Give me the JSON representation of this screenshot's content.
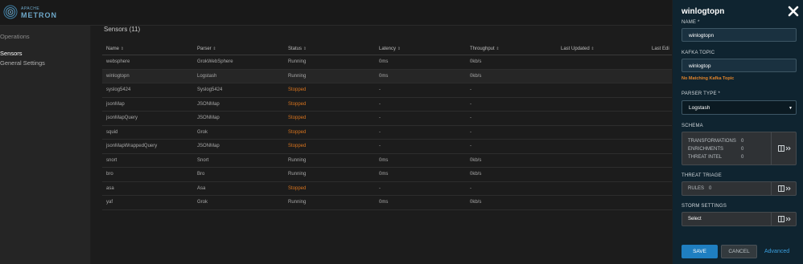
{
  "brand": {
    "small": "APACHE",
    "big": "METRON"
  },
  "nav": {
    "operations": "Operations",
    "sensors": "Sensors",
    "general_settings": "General Settings"
  },
  "main": {
    "title": "Sensors (11)",
    "columns": [
      "Name",
      "Parser",
      "Status",
      "Latency",
      "Throughput",
      "Last Updated",
      "Last Edi"
    ],
    "rows": [
      {
        "name": "websphere",
        "parser": "GrokWebSphere",
        "status": "Running",
        "latency": "0ms",
        "throughput": "0kb/s"
      },
      {
        "name": "winlogtopn",
        "parser": "Logstash",
        "status": "Running",
        "latency": "0ms",
        "throughput": "0kb/s"
      },
      {
        "name": "syslog5424",
        "parser": "Syslog5424",
        "status": "Stopped",
        "latency": "-",
        "throughput": "-"
      },
      {
        "name": "jsonMap",
        "parser": "JSONMap",
        "status": "Stopped",
        "latency": "-",
        "throughput": "-"
      },
      {
        "name": "jsonMapQuery",
        "parser": "JSONMap",
        "status": "Stopped",
        "latency": "-",
        "throughput": "-"
      },
      {
        "name": "squid",
        "parser": "Grok",
        "status": "Stopped",
        "latency": "-",
        "throughput": "-"
      },
      {
        "name": "jsonMapWrappedQuery",
        "parser": "JSONMap",
        "status": "Stopped",
        "latency": "-",
        "throughput": "-"
      },
      {
        "name": "snort",
        "parser": "Snort",
        "status": "Running",
        "latency": "0ms",
        "throughput": "0kb/s"
      },
      {
        "name": "bro",
        "parser": "Bro",
        "status": "Running",
        "latency": "0ms",
        "throughput": "0kb/s"
      },
      {
        "name": "asa",
        "parser": "Asa",
        "status": "Stopped",
        "latency": "-",
        "throughput": "-"
      },
      {
        "name": "yaf",
        "parser": "Grok",
        "status": "Running",
        "latency": "0ms",
        "throughput": "0kb/s"
      }
    ]
  },
  "panel": {
    "title": "winlogtopn",
    "name_label": "NAME *",
    "name_value": "winlogtopn",
    "kafka_label": "KAFKA TOPIC",
    "kafka_value": "winlogtop",
    "kafka_warning": "No Matching Kafka Topic",
    "parser_label": "PARSER TYPE *",
    "parser_value": "Logstash",
    "schema_label": "SCHEMA",
    "schema": [
      {
        "key": "TRANSFORMATIONS",
        "value": "0"
      },
      {
        "key": "ENRICHMENTS",
        "value": "0"
      },
      {
        "key": "THREAT INTEL",
        "value": "0"
      }
    ],
    "triage_label": "THREAT TRIAGE",
    "rules_label": "RULES",
    "rules_value": "0",
    "storm_label": "STORM SETTINGS",
    "storm_value": "Select",
    "save": "SAVE",
    "cancel": "CANCEL",
    "advanced": "Advanced"
  },
  "colors": {
    "accent": "#1f7fc1",
    "stopped": "#d8741e",
    "warning": "#e0832a",
    "panel_bg": "#0f2430"
  },
  "icons": {
    "close": "close-icon",
    "expand": "panel-expand-icon",
    "logo": "metron-logo-icon"
  }
}
